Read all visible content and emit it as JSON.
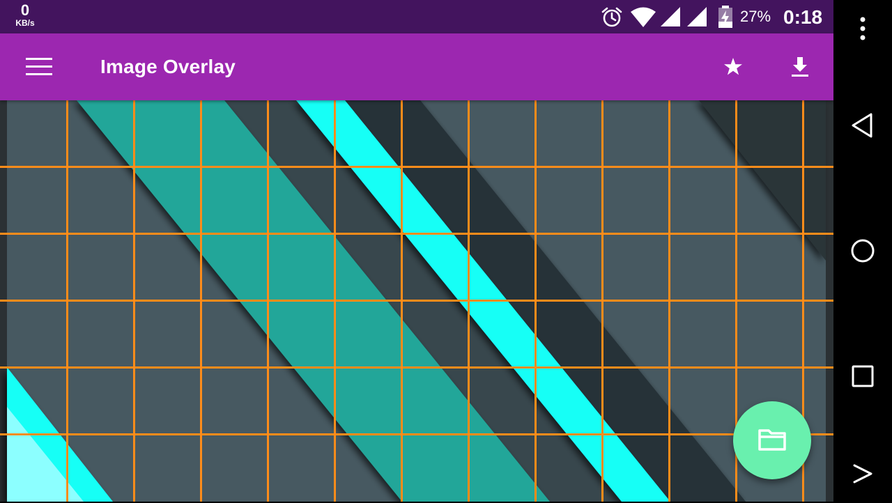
{
  "status_bar": {
    "net_speed_value": "0",
    "net_speed_unit": "KB/s",
    "icons": [
      "alarm-icon",
      "wifi-icon",
      "signal-icon",
      "signal-icon",
      "battery-charging-icon"
    ],
    "battery_percent": "27%",
    "time": "0:18",
    "background": "#43145e"
  },
  "app_bar": {
    "title": "Image Overlay",
    "background": "#9c27b0",
    "actions": [
      "star-icon",
      "download-icon"
    ]
  },
  "overlay": {
    "grid_color": "#ff8c1a",
    "columns": 13,
    "rows": 6
  },
  "fab": {
    "icon": "folder-icon",
    "color": "#69f0ae"
  },
  "nav_bar": {
    "buttons": [
      "overflow-menu-icon",
      "back-icon",
      "home-icon",
      "recents-icon",
      "forward-icon"
    ]
  }
}
